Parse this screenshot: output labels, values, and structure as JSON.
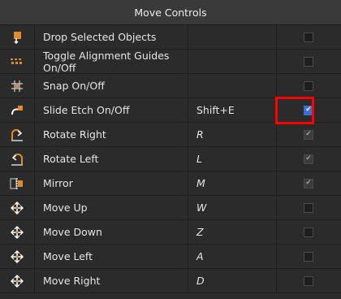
{
  "panel": {
    "title": "Move Controls"
  },
  "rows": [
    {
      "icon": "drop-objects-icon",
      "name": "Drop Selected Objects",
      "key": "",
      "checked": false,
      "disabled": false
    },
    {
      "icon": "alignment-guides-icon",
      "name": "Toggle Alignment Guides On/Off",
      "key": "",
      "checked": false,
      "disabled": false
    },
    {
      "icon": "snap-grid-icon",
      "name": "Snap On/Off",
      "key": "",
      "checked": false,
      "disabled": false
    },
    {
      "icon": "slide-etch-icon",
      "name": "Slide Etch On/Off",
      "key": "Shift+E",
      "checked": true,
      "disabled": false
    },
    {
      "icon": "rotate-right-icon",
      "name": "Rotate Right",
      "key": "R",
      "checked": true,
      "disabled": true
    },
    {
      "icon": "rotate-left-icon",
      "name": "Rotate Left",
      "key": "L",
      "checked": true,
      "disabled": true
    },
    {
      "icon": "mirror-icon",
      "name": "Mirror",
      "key": "M",
      "checked": true,
      "disabled": true
    },
    {
      "icon": "move-up-icon",
      "name": "Move Up",
      "key": "W",
      "checked": false,
      "disabled": false
    },
    {
      "icon": "move-down-icon",
      "name": "Move Down",
      "key": "Z",
      "checked": false,
      "disabled": false
    },
    {
      "icon": "move-left-icon",
      "name": "Move Left",
      "key": "A",
      "checked": false,
      "disabled": false
    },
    {
      "icon": "move-right-icon",
      "name": "Move Right",
      "key": "D",
      "checked": false,
      "disabled": false
    }
  ],
  "colors": {
    "accent": "#3b6fd6",
    "highlight": "#ff0000",
    "icon_orange": "#e08a2c"
  }
}
